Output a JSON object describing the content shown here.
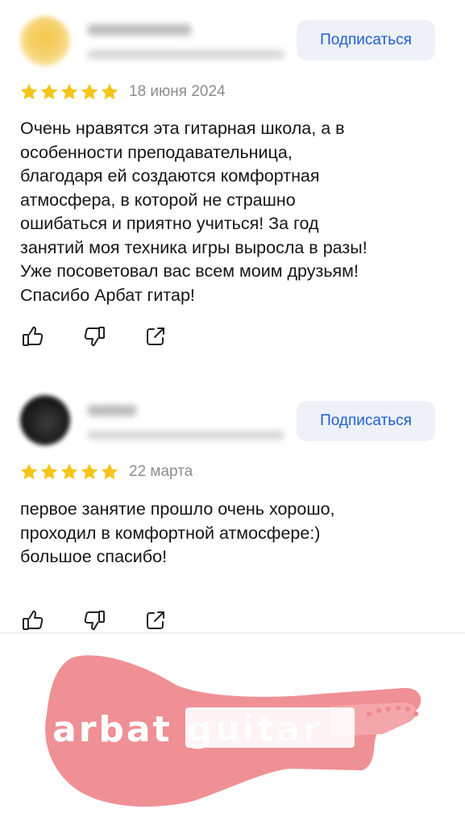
{
  "colors": {
    "star": "#f5c518",
    "accent": "#1f5fd1",
    "button_bg": "#eef1f7",
    "logo_pink": "#ee8a8f"
  },
  "reviews": [
    {
      "subscribe_label": "Подписаться",
      "rating": 5,
      "date": "18 июня 2024",
      "text": "Очень нравятся эта гитарная школа, а в\nособенности преподавательница,\nблагодаря ей создаются комфортная\nатмосфера, в которой не страшно\nошибаться и приятно учиться! За год\nзанятий моя техника игры выросла в разы!\nУже посоветовал вас всем моим друзьям!\nСпасибо Арбат гитар!"
    },
    {
      "subscribe_label": "Подписаться",
      "rating": 5,
      "date": "22 марта",
      "text": "первое занятие прошло очень хорошо,\nпроходил в комфортной атмосфере:)\nбольшое спасибо!"
    }
  ],
  "icons": {
    "like": "thumbs-up-icon",
    "dislike": "thumbs-down-icon",
    "share": "share-icon"
  },
  "logo": {
    "text": "arbat guitar"
  }
}
